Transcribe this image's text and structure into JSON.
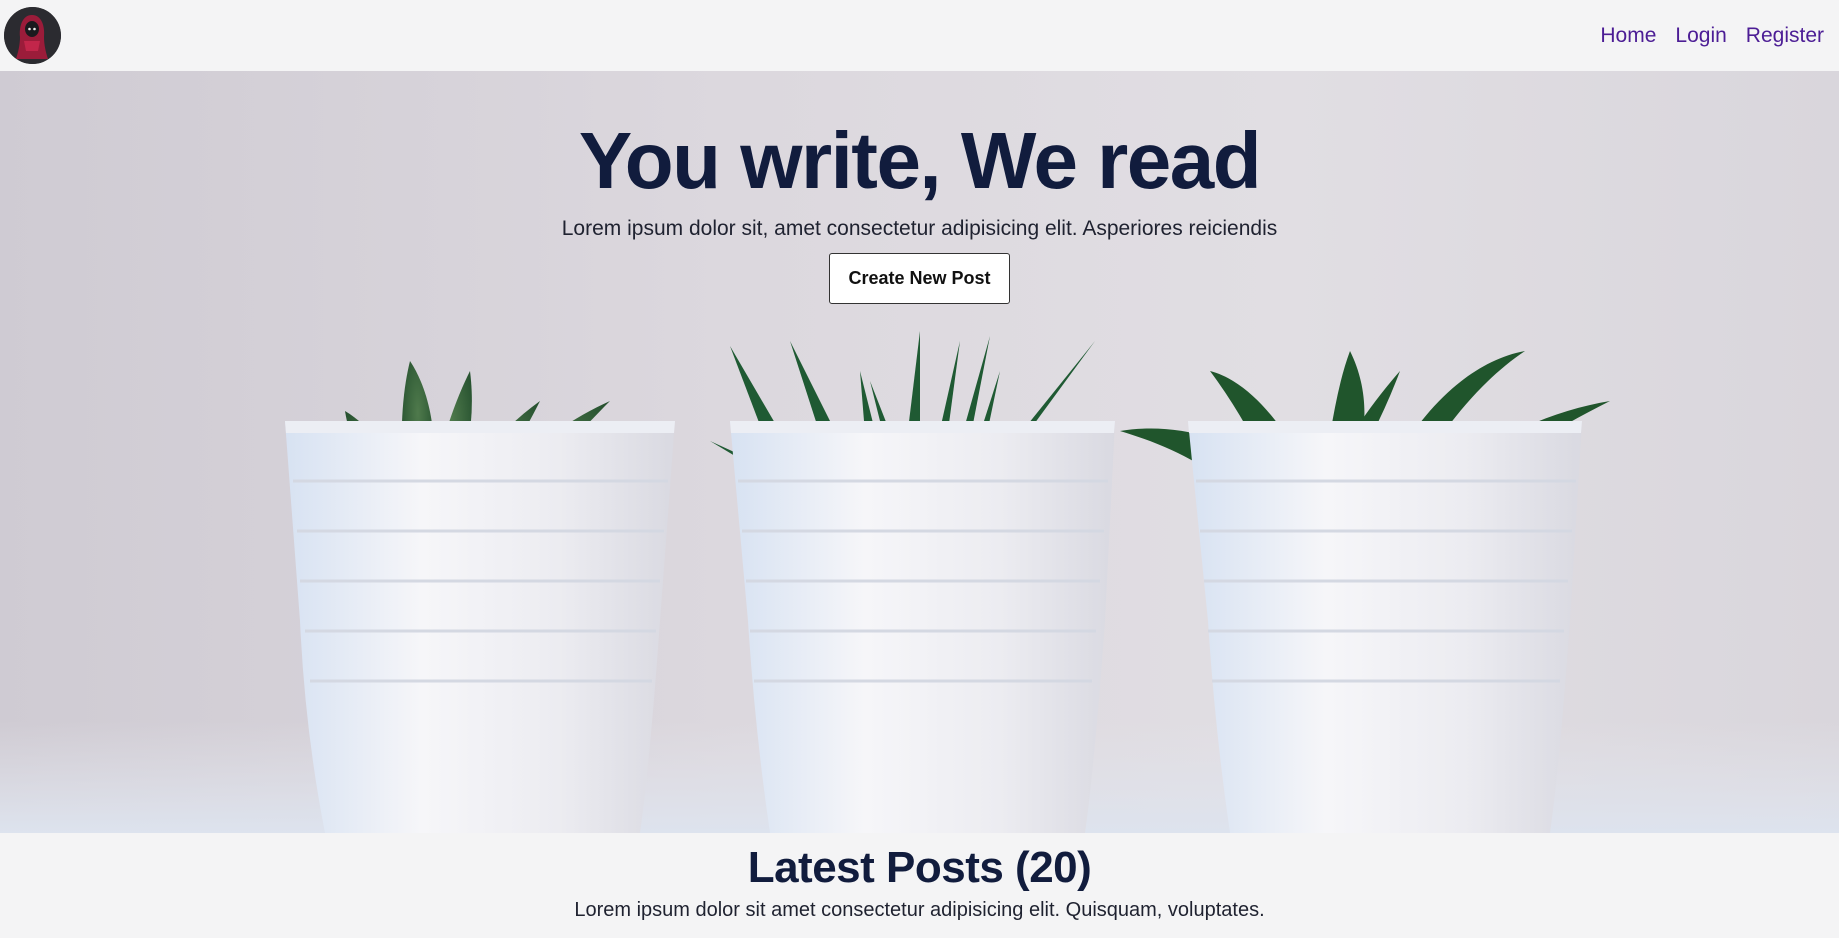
{
  "nav": {
    "logo_alt": "site logo",
    "links": [
      {
        "label": "Home"
      },
      {
        "label": "Login"
      },
      {
        "label": "Register"
      }
    ]
  },
  "hero": {
    "title": "You write, We read",
    "subtitle": "Lorem ipsum dolor sit, amet consectetur adipisicing elit. Asperiores reiciendis",
    "button_label": "Create New Post"
  },
  "latest": {
    "title": "Latest Posts (20)",
    "subtitle": "Lorem ipsum dolor sit amet consectetur adipisicing elit. Quisquam, voluptates."
  },
  "colors": {
    "nav_link": "#4c1d95",
    "heading": "#111c3d",
    "page_bg": "#f4f4f5"
  }
}
